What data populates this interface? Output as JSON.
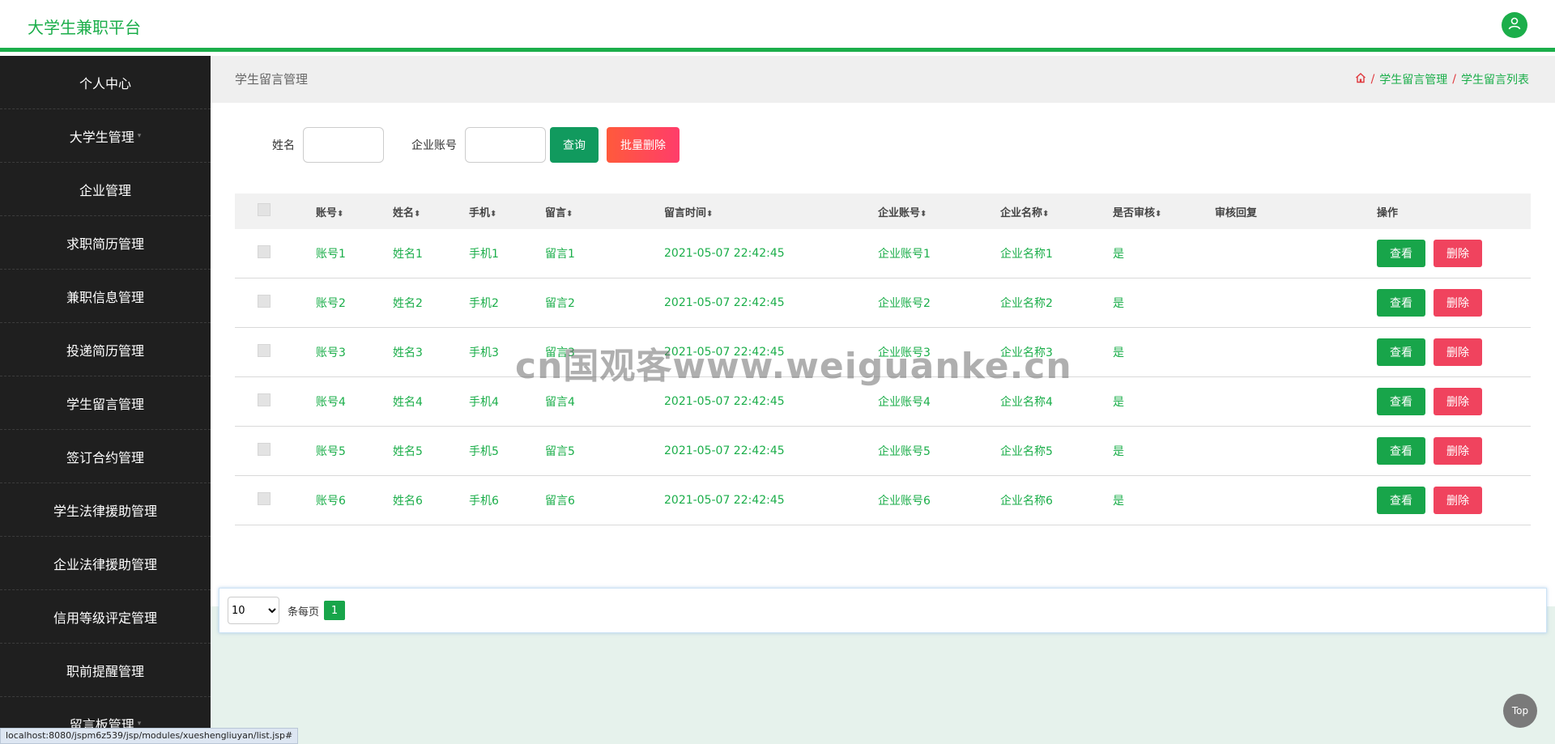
{
  "header": {
    "brand": "大学生兼职平台",
    "avatar_icon": "user-icon",
    "accent_color": "#1bae4a"
  },
  "sidebar": {
    "items": [
      {
        "label": "个人中心",
        "caret": false
      },
      {
        "label": "大学生管理",
        "caret": true
      },
      {
        "label": "企业管理",
        "caret": false
      },
      {
        "label": "求职简历管理",
        "caret": false
      },
      {
        "label": "兼职信息管理",
        "caret": false
      },
      {
        "label": "投递简历管理",
        "caret": false
      },
      {
        "label": "学生留言管理",
        "caret": false
      },
      {
        "label": "签订合约管理",
        "caret": false
      },
      {
        "label": "学生法律援助管理",
        "caret": false
      },
      {
        "label": "企业法律援助管理",
        "caret": false
      },
      {
        "label": "信用等级评定管理",
        "caret": false
      },
      {
        "label": "职前提醒管理",
        "caret": false
      },
      {
        "label": "留言板管理",
        "caret": true
      }
    ]
  },
  "titlebar": {
    "title": "学生留言管理",
    "breadcrumb": {
      "home_icon": "home-icon",
      "items": [
        "学生留言管理",
        "学生留言列表"
      ],
      "separator": "/"
    }
  },
  "search": {
    "name_label": "姓名",
    "name_value": "",
    "company_label": "企业账号",
    "company_value": "",
    "query_label": "查询",
    "batch_delete_label": "批量删除"
  },
  "table": {
    "headers": {
      "account": "账号",
      "name": "姓名",
      "phone": "手机",
      "message": "留言",
      "time": "留言时间",
      "company_account": "企业账号",
      "company_name": "企业名称",
      "reviewed": "是否审核",
      "reply": "审核回复",
      "actions": "操作"
    },
    "sort_icon": "sort-icon",
    "rows": [
      {
        "account": "账号1",
        "name": "姓名1",
        "phone": "手机1",
        "message": "留言1",
        "time": "2021-05-07 22:42:45",
        "company_account": "企业账号1",
        "company_name": "企业名称1",
        "reviewed": "是",
        "reply": ""
      },
      {
        "account": "账号2",
        "name": "姓名2",
        "phone": "手机2",
        "message": "留言2",
        "time": "2021-05-07 22:42:45",
        "company_account": "企业账号2",
        "company_name": "企业名称2",
        "reviewed": "是",
        "reply": ""
      },
      {
        "account": "账号3",
        "name": "姓名3",
        "phone": "手机3",
        "message": "留言3",
        "time": "2021-05-07 22:42:45",
        "company_account": "企业账号3",
        "company_name": "企业名称3",
        "reviewed": "是",
        "reply": ""
      },
      {
        "account": "账号4",
        "name": "姓名4",
        "phone": "手机4",
        "message": "留言4",
        "time": "2021-05-07 22:42:45",
        "company_account": "企业账号4",
        "company_name": "企业名称4",
        "reviewed": "是",
        "reply": ""
      },
      {
        "account": "账号5",
        "name": "姓名5",
        "phone": "手机5",
        "message": "留言5",
        "time": "2021-05-07 22:42:45",
        "company_account": "企业账号5",
        "company_name": "企业名称5",
        "reviewed": "是",
        "reply": ""
      },
      {
        "account": "账号6",
        "name": "姓名6",
        "phone": "手机6",
        "message": "留言6",
        "time": "2021-05-07 22:42:45",
        "company_account": "企业账号6",
        "company_name": "企业名称6",
        "reviewed": "是",
        "reply": ""
      }
    ],
    "view_label": "查看",
    "delete_label": "删除"
  },
  "pager": {
    "page_size": "10",
    "per_page_label": "条每页",
    "current_page": "1"
  },
  "watermark": "cn国观客www.weiguanke.cn",
  "top_button": "Top",
  "status_url": "localhost:8080/jspm6z539/jsp/modules/xueshengliuyan/list.jsp#"
}
